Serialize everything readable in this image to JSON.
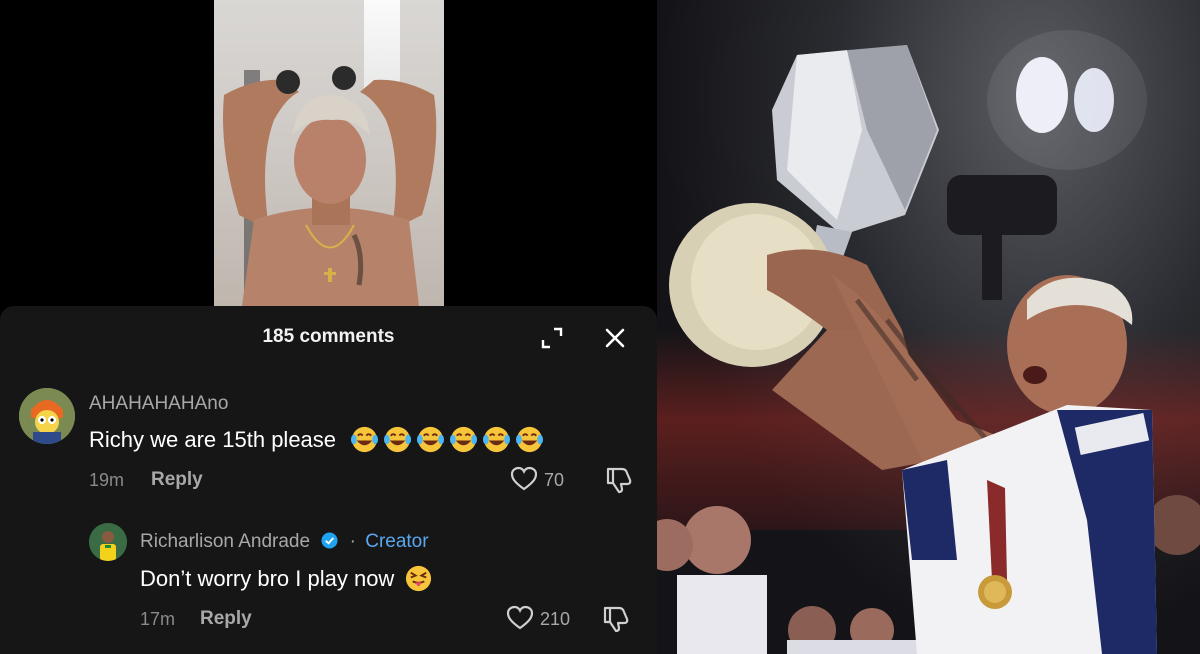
{
  "comments_panel": {
    "count_label": "185 comments"
  },
  "comments": [
    {
      "username": "AHAHAHAHAno",
      "text": "Richy we are 15th please",
      "emoji_count": 6,
      "time": "19m",
      "reply_label": "Reply",
      "likes": "70"
    },
    {
      "username": "Richarlison Andrade",
      "verified": true,
      "badge_separator": "·",
      "badge": "Creator",
      "text": "Don’t worry bro I play now",
      "time": "17m",
      "reply_label": "Reply",
      "likes": "210"
    }
  ],
  "colors": {
    "sheet_bg": "#161616",
    "creator_blue": "#5aa7f0",
    "verified_blue": "#20a3f0",
    "muted_text": "#a8a8a8"
  },
  "icons": [
    "expand-icon",
    "close-icon",
    "heart-icon",
    "dislike-icon",
    "verified-icon",
    "laughing-emoji",
    "tongue-emoji"
  ]
}
